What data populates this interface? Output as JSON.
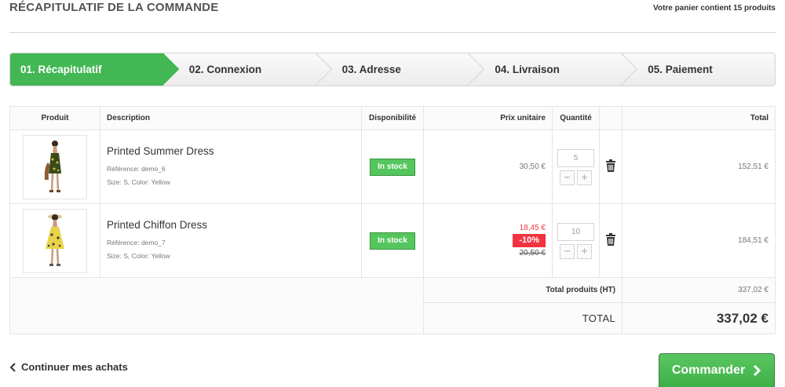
{
  "page": {
    "title": "Récapitulatif de la commande",
    "cart_summary": "Votre panier contient 15 produits"
  },
  "steps": [
    {
      "label": "01. Récapitulatif",
      "active": true
    },
    {
      "label": "02. Connexion",
      "active": false
    },
    {
      "label": "03. Adresse",
      "active": false
    },
    {
      "label": "04. Livraison",
      "active": false
    },
    {
      "label": "05. Paiement",
      "active": false
    }
  ],
  "table": {
    "headers": {
      "product": "Produit",
      "description": "Description",
      "availability": "Disponibilité",
      "unit_price": "Prix unitaire",
      "quantity": "Quantité",
      "total": "Total"
    },
    "items": [
      {
        "name": "Printed Summer Dress",
        "reference": "Référence: demo_6",
        "attributes": "Size: S, Color: Yellow",
        "availability": "In stock",
        "unit_price": "30,50 €",
        "quantity": "5",
        "total": "152,51 €",
        "icon": "dress-thumbnail-icon"
      },
      {
        "name": "Printed Chiffon Dress",
        "reference": "Référence: demo_7",
        "attributes": "Size: S, Color: Yellow",
        "availability": "In stock",
        "unit_price": "18,45 €",
        "discount": "-10%",
        "old_price": "20,50 €",
        "quantity": "10",
        "total": "184,51 €",
        "icon": "dress-thumbnail-icon"
      }
    ],
    "qty_minus": "−",
    "qty_plus": "+",
    "subtotal_label": "Total produits (HT)",
    "subtotal_value": "337,02 €",
    "grand_total_label": "TOTAL",
    "grand_total_value": "337,02 €"
  },
  "actions": {
    "continue_label": "Continuer mes achats",
    "order_label": "Commander"
  },
  "colors": {
    "accent_green": "#43b754",
    "discount_red": "#f13340",
    "border": "#d6d4d4"
  }
}
